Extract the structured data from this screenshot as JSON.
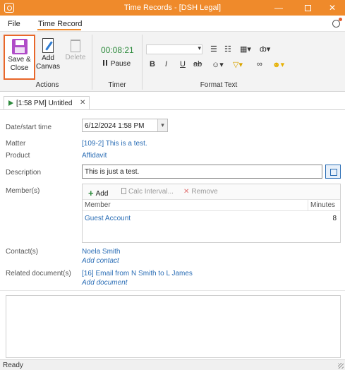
{
  "window": {
    "title": "Time Records - [DSH Legal]",
    "controls": {
      "minimize": "—",
      "maximize": "",
      "close": "✕"
    }
  },
  "menu": {
    "file": "File",
    "time_record": "Time Record"
  },
  "ribbon": {
    "actions": {
      "label": "Actions",
      "save_close": "Save &\nClose",
      "add_canvas": "Add\nCanvas",
      "delete": "Delete"
    },
    "timer": {
      "label": "Timer",
      "time": "00:08:21",
      "pause": "Pause"
    },
    "format_text": {
      "label": "Format Text",
      "bold": "B",
      "italic": "I",
      "underline": "U",
      "strike": "ab"
    }
  },
  "doc_tab": {
    "label": "[1:58 PM] Untitled",
    "close": "✕"
  },
  "form": {
    "date_label": "Date/start time",
    "date_value": "6/12/2024 1:58 PM",
    "matter_label": "Matter",
    "matter_value": "[109-2] This is a test.",
    "product_label": "Product",
    "product_value": "Affidavit",
    "description_label": "Description",
    "description_value": "This is just a test.",
    "members_label": "Member(s)",
    "members_toolbar": {
      "add": "Add",
      "calc": "Calc Interval...",
      "remove": "Remove"
    },
    "members_columns": {
      "member": "Member",
      "minutes": "Minutes"
    },
    "members_rows": [
      {
        "member": "Guest Account",
        "minutes": "8"
      }
    ],
    "contacts_label": "Contact(s)",
    "contact_value": "Noela Smith",
    "add_contact": "Add contact",
    "related_label": "Related document(s)",
    "related_value": "[16] Email from N Smith to L James",
    "add_document": "Add document"
  },
  "status": {
    "text": "Ready"
  },
  "colors": {
    "accent": "#ef8a2b",
    "link": "#2a6db5",
    "timer": "#2e8b3d",
    "highlight_border": "#e8672a"
  }
}
